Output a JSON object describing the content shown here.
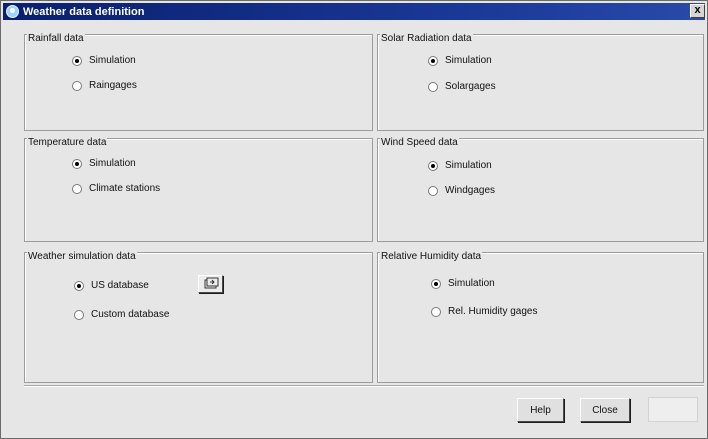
{
  "window": {
    "title": "Weather data definition",
    "close_glyph": "x"
  },
  "groups": {
    "rainfall": {
      "title": "Rainfall data",
      "options": [
        "Simulation",
        "Raingages"
      ],
      "selected": 0
    },
    "solar": {
      "title": "Solar Radiation data",
      "options": [
        "Simulation",
        "Solargages"
      ],
      "selected": 0
    },
    "temperature": {
      "title": "Temperature data",
      "options": [
        "Simulation",
        "Climate stations"
      ],
      "selected": 0
    },
    "wind": {
      "title": "Wind Speed data",
      "options": [
        "Simulation",
        "Windgages"
      ],
      "selected": 0
    },
    "weather_sim": {
      "title": "Weather simulation data",
      "options": [
        "US database",
        "Custom database"
      ],
      "selected": 0
    },
    "humidity": {
      "title": "Relative Humidity data",
      "options": [
        "Simulation",
        "Rel. Humidity gages"
      ],
      "selected": 0
    }
  },
  "buttons": {
    "help": "Help",
    "close": "Close"
  },
  "icons": {
    "app": "weather-app-icon",
    "database_browse": "open-folder-icon"
  }
}
